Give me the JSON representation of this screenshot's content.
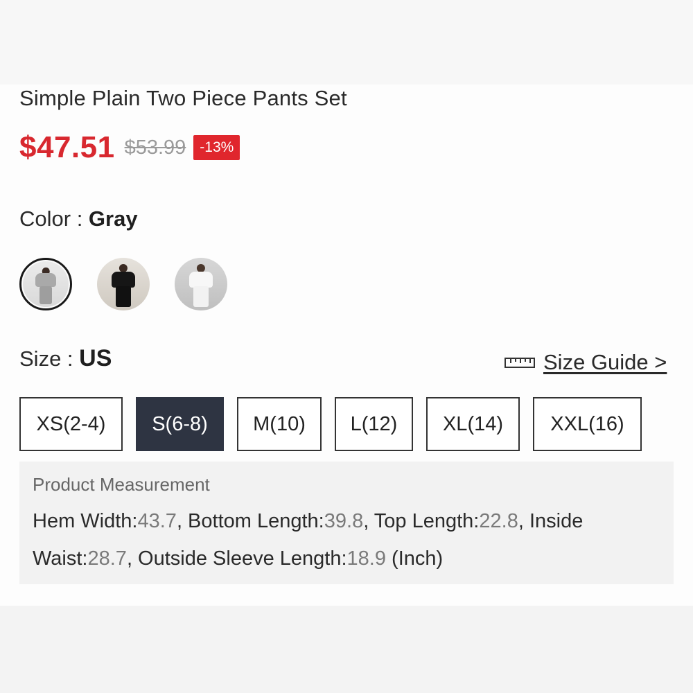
{
  "product": {
    "title": "Simple Plain Two Piece Pants Set",
    "price": "$47.51",
    "original_price": "$53.99",
    "discount": "-13%"
  },
  "color": {
    "label": "Color : ",
    "selected": "Gray",
    "swatches": [
      {
        "name": "Gray",
        "selected": true
      },
      {
        "name": "Black",
        "selected": false
      },
      {
        "name": "White",
        "selected": false
      }
    ]
  },
  "size": {
    "label": "Size : ",
    "system": "US",
    "guide_label": "Size Guide >",
    "options": [
      {
        "label": "XS(2-4)",
        "selected": false
      },
      {
        "label": "S(6-8)",
        "selected": true
      },
      {
        "label": "M(10)",
        "selected": false
      },
      {
        "label": "L(12)",
        "selected": false
      },
      {
        "label": "XL(14)",
        "selected": false
      },
      {
        "label": "XXL(16)",
        "selected": false
      }
    ]
  },
  "measurement": {
    "title": "Product Measurement",
    "hem_width_label": "Hem Width:",
    "hem_width": "43.7",
    "bottom_length_label": ", Bottom Length:",
    "bottom_length": "39.8",
    "top_length_label": ", Top Length:",
    "top_length": "22.8",
    "inside_waist_label": ", Inside Waist:",
    "inside_waist": "28.7",
    "sleeve_label": ", Outside Sleeve Length:",
    "sleeve_length": "18.9",
    "unit": " (Inch)"
  },
  "colors": {
    "price_red": "#d8282f",
    "badge_red": "#e0262d",
    "selected_size_bg": "#2e3442"
  }
}
